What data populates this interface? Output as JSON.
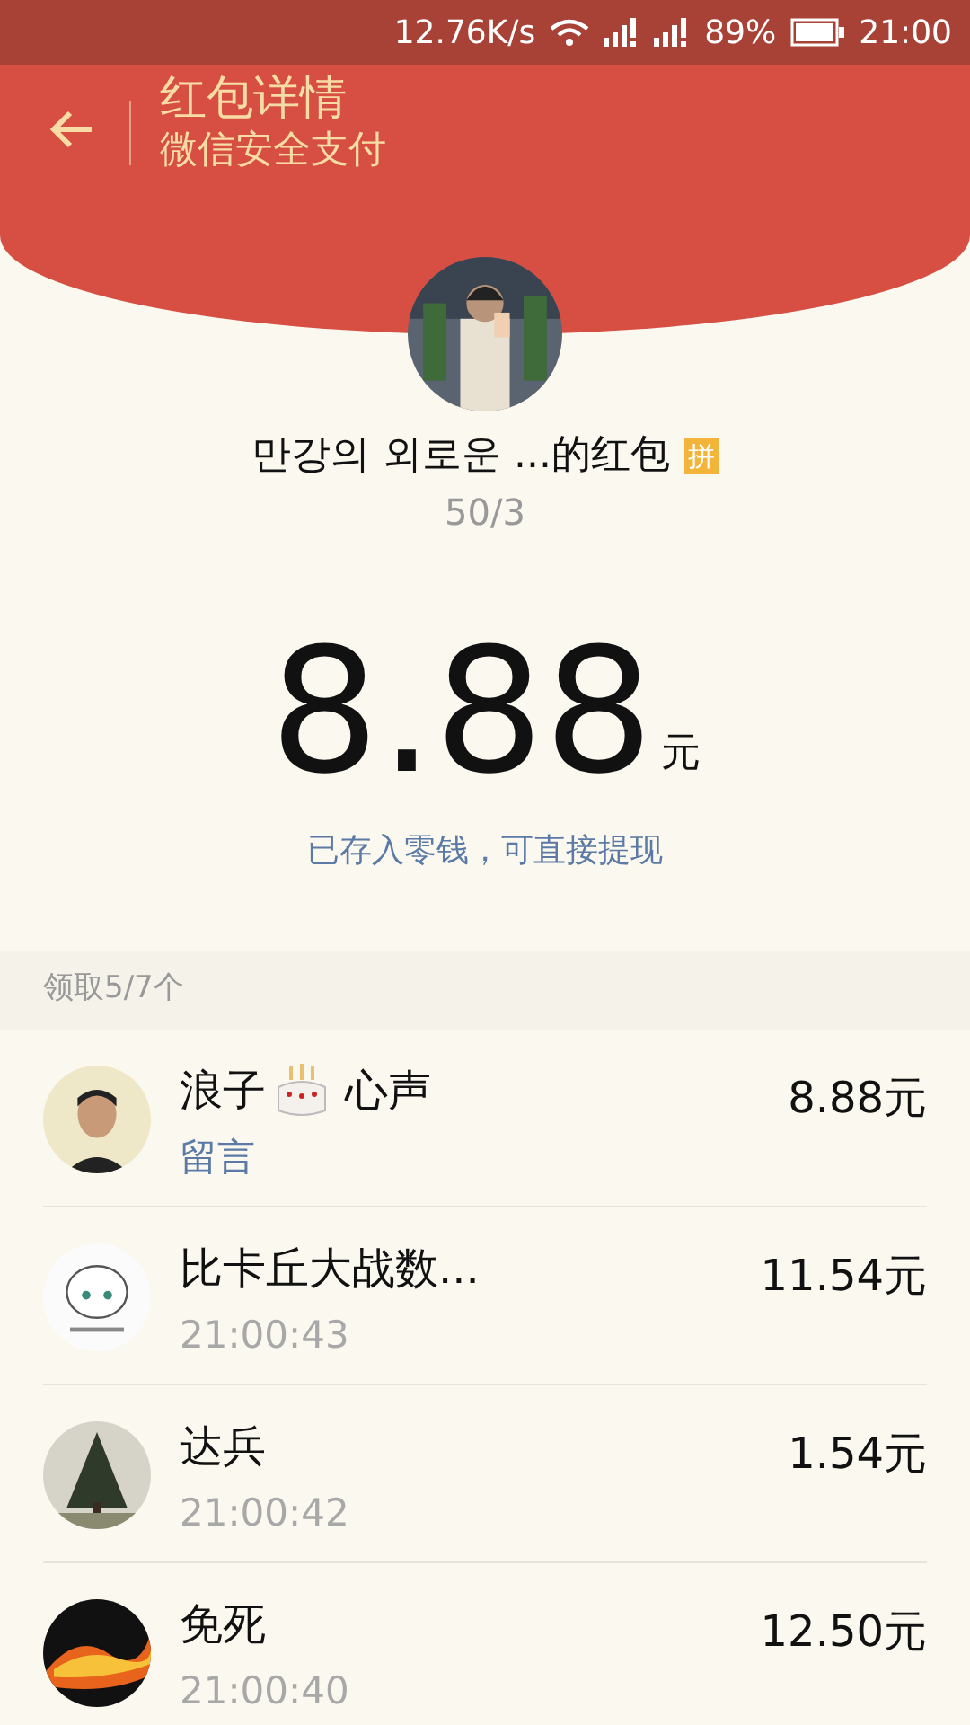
{
  "status_bar": {
    "speed": "12.76K/s",
    "battery": "89%",
    "time": "21:00"
  },
  "header": {
    "title": "红包详情",
    "subtitle": "微信安全支付"
  },
  "sender": {
    "title": "만강의 외로운 ...的红包",
    "badge": "拼",
    "count": "50/3"
  },
  "amount": {
    "value": "8.88",
    "unit": "元",
    "note": "已存入零钱，可直接提现"
  },
  "received_header": "领取5/7个",
  "receivers": [
    {
      "name": "浪子",
      "cake": true,
      "name_suffix": "心声",
      "kind": "message",
      "sub": "留言",
      "amount": "8.88元"
    },
    {
      "name": "比卡丘大战数...",
      "cake": false,
      "kind": "time",
      "sub": "21:00:43",
      "amount": "11.54元"
    },
    {
      "name": "达兵",
      "cake": false,
      "kind": "time",
      "sub": "21:00:42",
      "amount": "1.54元"
    },
    {
      "name": "免死",
      "cake": false,
      "kind": "time",
      "sub": "21:00:40",
      "amount": "12.50元"
    }
  ]
}
